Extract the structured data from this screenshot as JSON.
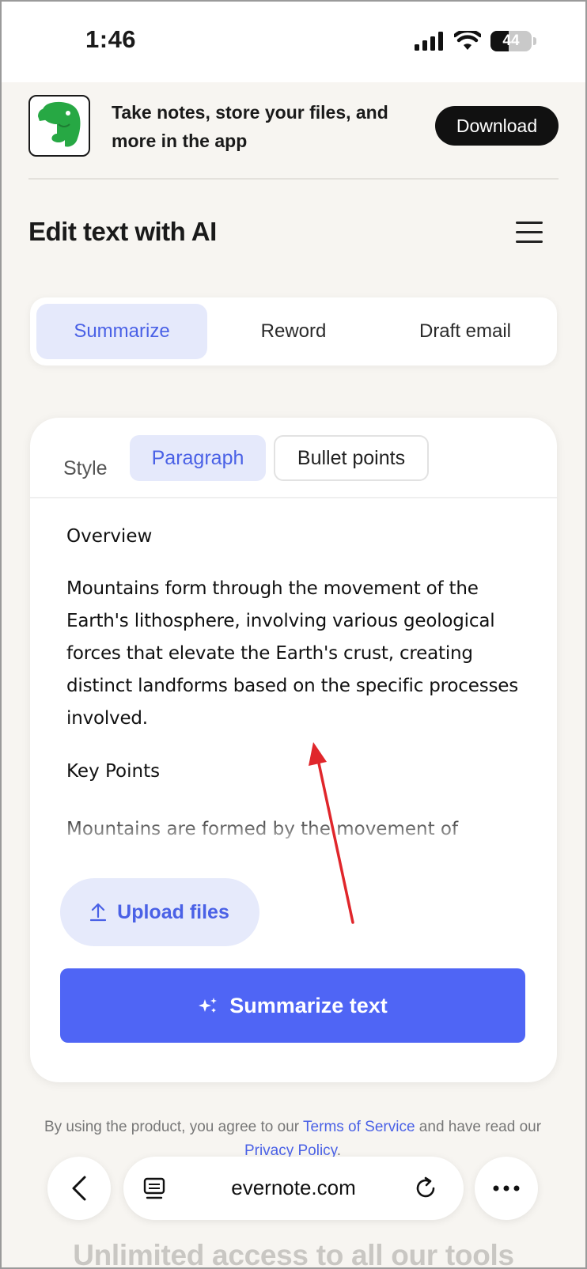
{
  "status_bar": {
    "time": "1:46",
    "battery": "44",
    "battery_level": 0.44
  },
  "banner": {
    "text": "Take notes, store your files, and more in the app",
    "download_label": "Download"
  },
  "header": {
    "title": "Edit text with AI"
  },
  "tabs": [
    {
      "label": "Summarize",
      "active": true
    },
    {
      "label": "Reword",
      "active": false
    },
    {
      "label": "Draft email",
      "active": false
    }
  ],
  "style": {
    "label": "Style",
    "options": [
      {
        "label": "Paragraph",
        "active": true
      },
      {
        "label": "Bullet points",
        "active": false
      }
    ]
  },
  "content": {
    "overview_heading": "Overview",
    "overview_text": "Mountains form through the movement of the Earth's lithosphere, involving various geological forces that elevate the Earth's crust, creating distinct landforms based on the specific processes involved.",
    "key_points_heading": "Key Points",
    "key_points_text": "Mountains are formed by the movement of"
  },
  "actions": {
    "upload_label": "Upload files",
    "summarize_label": "Summarize text"
  },
  "legal": {
    "prefix": "By using the product, you agree to our ",
    "terms_link": "Terms of Service",
    "middle": " and have read our ",
    "privacy_link": "Privacy Policy",
    "suffix": "."
  },
  "browser": {
    "url": "evernote.com"
  },
  "teaser": "Unlimited access to all our tools",
  "colors": {
    "accent": "#4f65f5",
    "accent_text": "#4a61e6",
    "accent_soft": "#e5e9fb",
    "annotation_arrow": "#e0262b"
  }
}
